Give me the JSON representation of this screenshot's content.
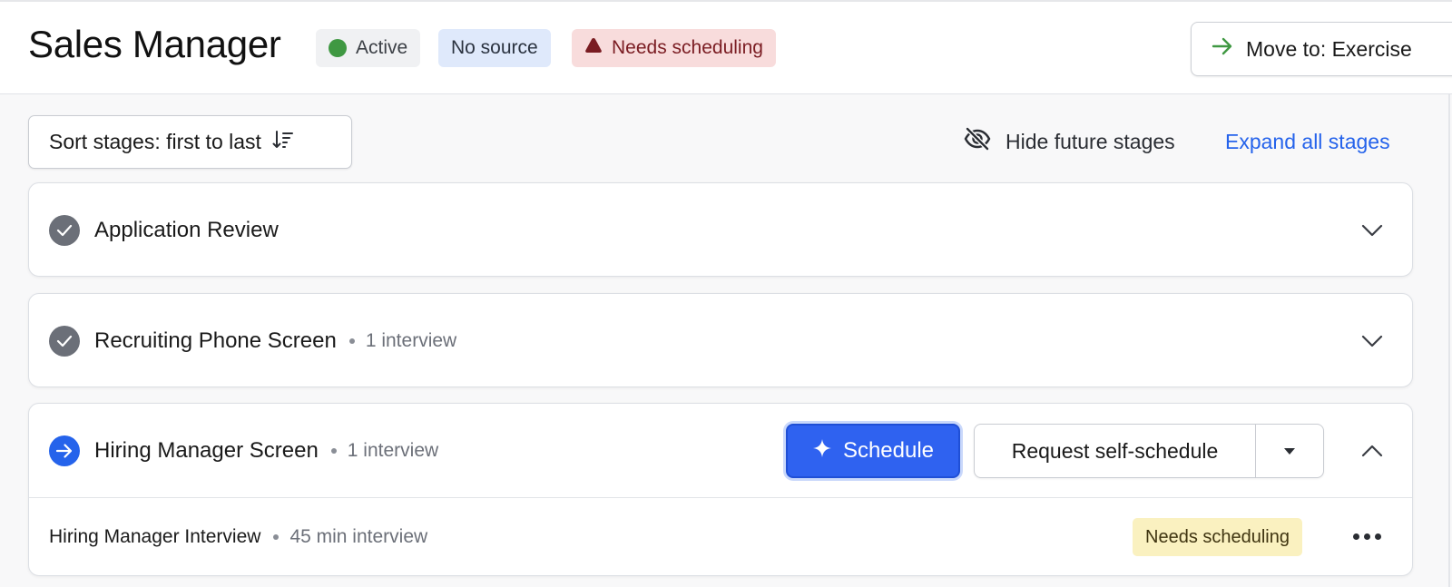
{
  "header": {
    "title": "Sales Manager",
    "badges": {
      "active": "Active",
      "no_source": "No source",
      "needs_scheduling": "Needs scheduling"
    },
    "move_button": "Move to: Exercise"
  },
  "toolbar": {
    "sort_label": "Sort stages: first to last",
    "hide_future": "Hide future stages",
    "expand_all": "Expand all stages"
  },
  "stages": [
    {
      "name": "Application Review",
      "status": "completed",
      "meta": ""
    },
    {
      "name": "Recruiting Phone Screen",
      "status": "completed",
      "meta": "1 interview"
    },
    {
      "name": "Hiring Manager Screen",
      "status": "current",
      "meta": "1 interview"
    }
  ],
  "current_stage_actions": {
    "schedule": "Schedule",
    "request_self_schedule": "Request self-schedule"
  },
  "interviews": [
    {
      "name": "Hiring Manager Interview",
      "duration": "45 min interview",
      "status": "Needs scheduling"
    }
  ],
  "colors": {
    "accent": "#2563eb",
    "active_green": "#3f9842",
    "needs_red_bg": "#f8dcdc",
    "needs_yellow_bg": "#faf1c0"
  }
}
